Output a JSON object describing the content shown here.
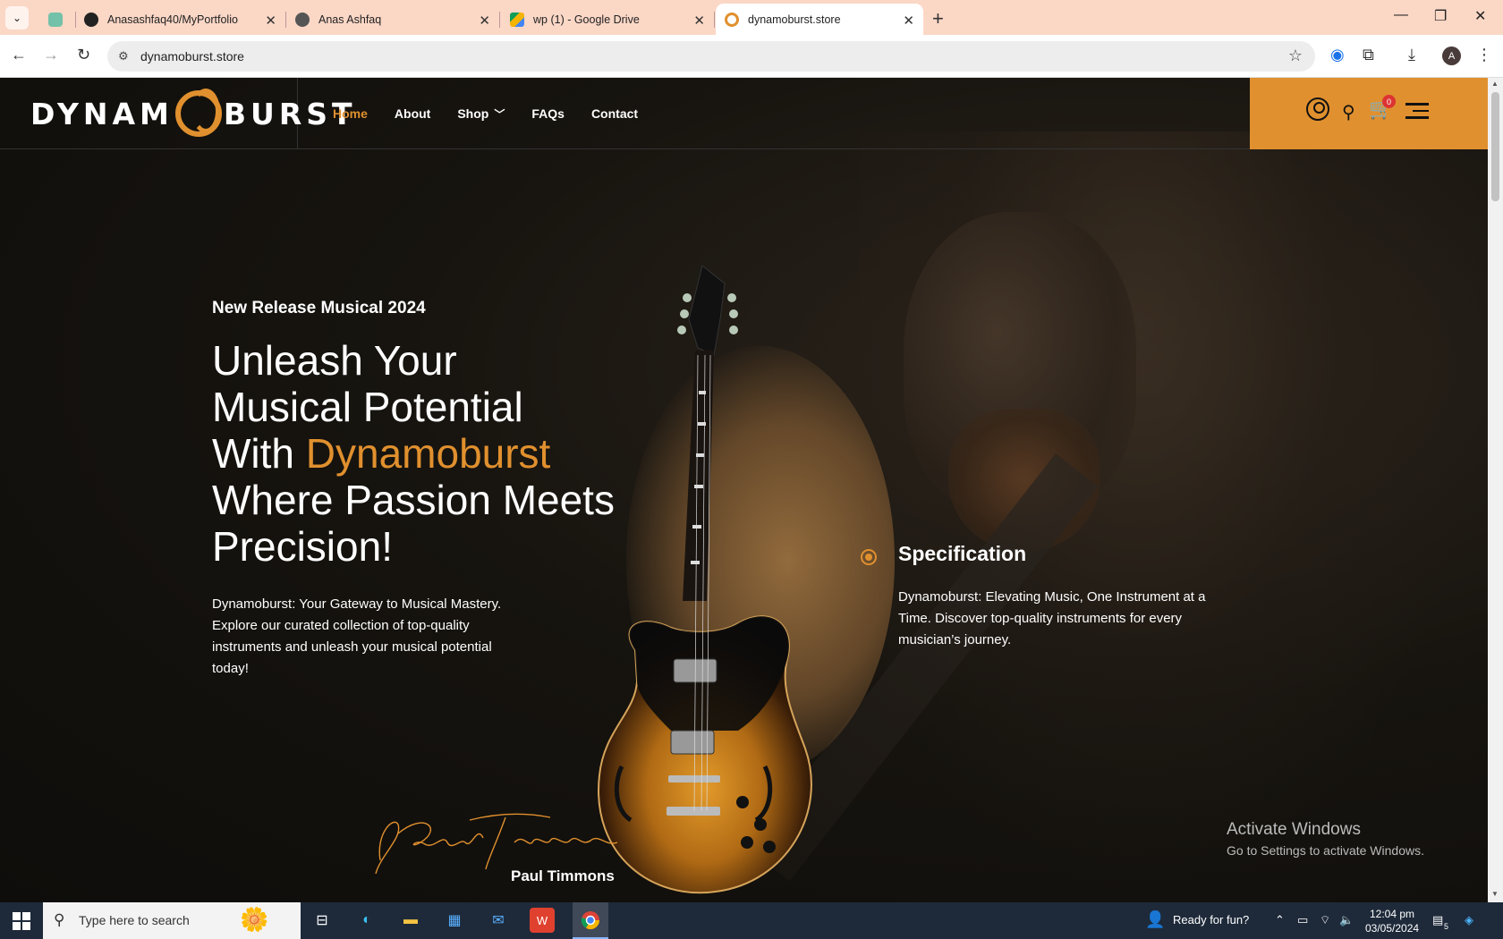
{
  "browser": {
    "tabs": [
      {
        "title": "",
        "favicon_color": "#73c1a8"
      },
      {
        "title": "Anasashfaq40/MyPortfolio",
        "favicon_color": "#222222"
      },
      {
        "title": "Anas Ashfaq",
        "favicon_color": "#555555"
      },
      {
        "title": "wp (1) - Google Drive",
        "favicon_color": "#f4b400"
      },
      {
        "title": "dynamoburst.store",
        "favicon_color": "#e0902e"
      }
    ],
    "url": "dynamoburst.store",
    "profile_initial": "A"
  },
  "site": {
    "logo_left": "DYNAM",
    "logo_right": "BURST",
    "nav": [
      {
        "label": "Home",
        "active": true
      },
      {
        "label": "About"
      },
      {
        "label": "Shop",
        "has_dropdown": true
      },
      {
        "label": "FAQs"
      },
      {
        "label": "Contact"
      }
    ],
    "cart_count": "0",
    "hero": {
      "subtitle": "New Release Musical 2024",
      "title_line1": "Unleash Your",
      "title_line2": "Musical Potential",
      "title_with": "With ",
      "title_brand": "Dynamoburst",
      "title_line4": "Where Passion Meets",
      "title_line5": "Precision!",
      "description": "Dynamoburst: Your Gateway to Musical Mastery. Explore our curated collection of top-quality instruments and unleash your musical potential today!"
    },
    "specification": {
      "title": "Specification",
      "description": "Dynamoburst: Elevating Music, One Instrument at a Time. Discover top-quality instruments for every musician’s journey."
    },
    "signature": {
      "script_text": "Paul Timmons",
      "name": "Paul Timmons"
    },
    "accent_color": "#e0902e"
  },
  "watermark": {
    "line1": "Activate Windows",
    "line2": "Go to Settings to activate Windows."
  },
  "taskbar": {
    "search_placeholder": "Type here to search",
    "weather_text": "Ready for fun?",
    "time": "12:04 pm",
    "date": "03/05/2024",
    "notification_count": "5"
  }
}
